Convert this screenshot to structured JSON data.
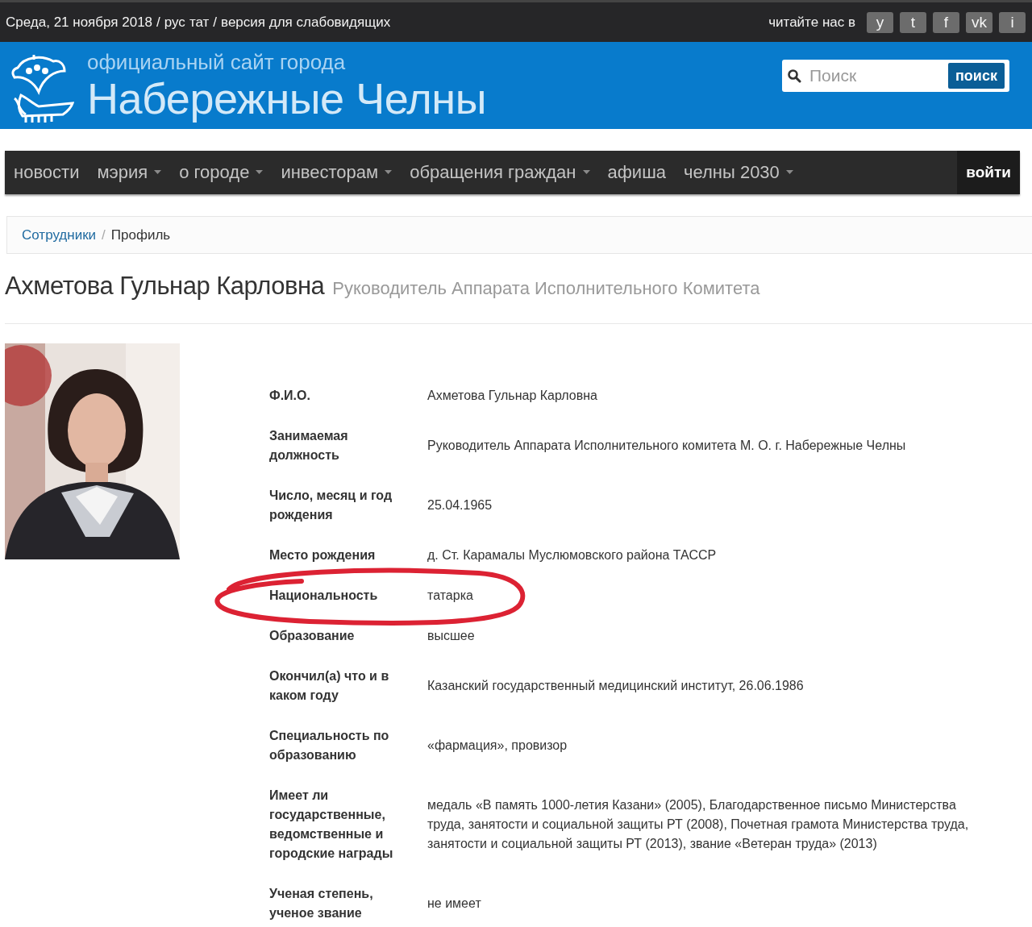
{
  "top_bar": {
    "date": "Среда, 21 ноября 2018",
    "separator_1": "/",
    "languages": [
      {
        "label": "рус"
      },
      {
        "label": "тат"
      }
    ],
    "separator_2": "/",
    "accessibility_link": "версия для слабовидящих",
    "social_label": "читайте нас в",
    "social_buttons": [
      "y",
      "t",
      "f",
      "vk",
      "i"
    ]
  },
  "header": {
    "subtitle": "официальный сайт города",
    "title": "Набережные Челны",
    "search": {
      "placeholder": "Поиск",
      "button": "поиск"
    }
  },
  "nav": {
    "items": [
      {
        "label": "новости",
        "has_dropdown": false
      },
      {
        "label": "мэрия",
        "has_dropdown": true
      },
      {
        "label": "о городе",
        "has_dropdown": true
      },
      {
        "label": "инвесторам",
        "has_dropdown": true
      },
      {
        "label": "обращения граждан",
        "has_dropdown": true
      },
      {
        "label": "афиша",
        "has_dropdown": false
      },
      {
        "label": "челны 2030",
        "has_dropdown": true
      }
    ],
    "login": "войти"
  },
  "breadcrumb": {
    "link": "Сотрудники",
    "separator": "/",
    "current": "Профиль"
  },
  "profile": {
    "name": "Ахметова Гульнар Карловна",
    "position": "Руководитель Аппарата Исполнительного Комитета",
    "rows": [
      {
        "label": "Ф.И.О.",
        "value": "Ахметова Гульнар Карловна",
        "circled": false
      },
      {
        "label": "Занимаемая должность",
        "value": "Руководитель Аппарата Исполнительного комитета М. О. г. Набережные Челны",
        "circled": false
      },
      {
        "label": "Число, месяц и год рождения",
        "value": "25.04.1965",
        "circled": false
      },
      {
        "label": "Место рождения",
        "value": "д. Ст. Карамалы Муслюмовского района ТАССР",
        "circled": false
      },
      {
        "label": "Национальность",
        "value": "татарка",
        "circled": true
      },
      {
        "label": "Образование",
        "value": "высшее",
        "circled": false
      },
      {
        "label": "Окончил(а) что и в каком году",
        "value": "Казанский государственный медицинский институт, 26.06.1986",
        "circled": false
      },
      {
        "label": "Специальность по образованию",
        "value": "«фармация», провизор",
        "circled": false
      },
      {
        "label": "Имеет ли государственные, ведомственные и городские награды",
        "value": "медаль «В память 1000-летия Казани» (2005), Благодарственное письмо Министерства труда, занятости и социальной защиты РТ (2008), Почетная грамота Министерства труда, занятости и социальной защиты РТ (2013), звание «Ветеран труда» (2013)",
        "circled": false
      },
      {
        "label": "Ученая степень, ученое звание",
        "value": "не имеет",
        "circled": false
      }
    ]
  }
}
